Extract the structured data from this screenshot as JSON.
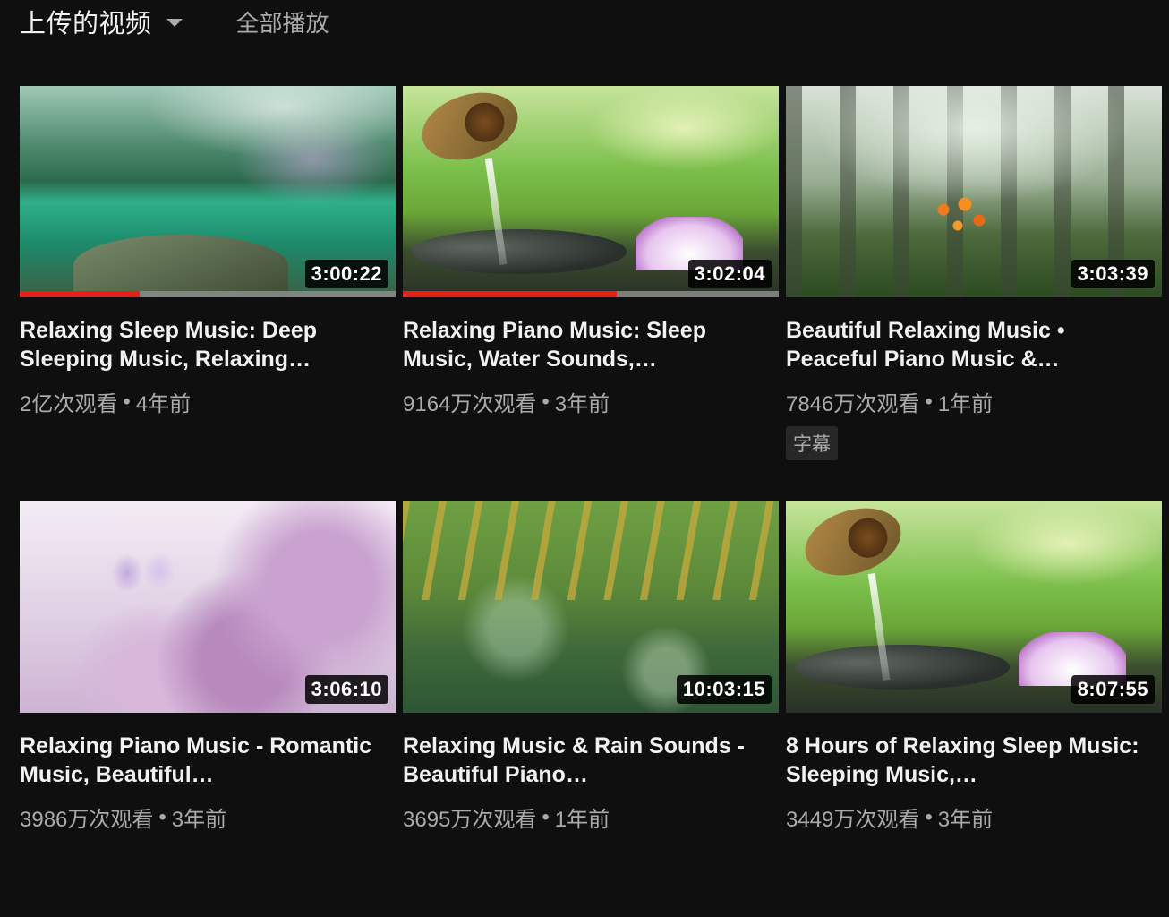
{
  "header": {
    "section_title": "上传的视频",
    "play_all": "全部播放"
  },
  "colors": {
    "background": "#0f0f0f",
    "progress": "#e62117",
    "meta_text": "#aaaaaa"
  },
  "videos": [
    {
      "title": "Relaxing Sleep Music: Deep Sleeping Music, Relaxing…",
      "duration": "3:00:22",
      "views": "2亿次观看",
      "age": "4年前",
      "watch_progress": 0.32,
      "badge": ""
    },
    {
      "title": "Relaxing Piano Music: Sleep Music, Water Sounds,…",
      "duration": "3:02:04",
      "views": "9164万次观看",
      "age": "3年前",
      "watch_progress": 0.57,
      "badge": ""
    },
    {
      "title": "Beautiful Relaxing Music • Peaceful Piano Music &…",
      "duration": "3:03:39",
      "views": "7846万次观看",
      "age": "1年前",
      "watch_progress": 0,
      "badge": "字幕"
    },
    {
      "title": "Relaxing Piano Music - Romantic Music, Beautiful…",
      "duration": "3:06:10",
      "views": "3986万次观看",
      "age": "3年前",
      "watch_progress": 0,
      "badge": ""
    },
    {
      "title": "Relaxing Music & Rain Sounds - Beautiful Piano…",
      "duration": "10:03:15",
      "views": "3695万次观看",
      "age": "1年前",
      "watch_progress": 0,
      "badge": ""
    },
    {
      "title": "8 Hours of Relaxing Sleep Music: Sleeping Music,…",
      "duration": "8:07:55",
      "views": "3449万次观看",
      "age": "3年前",
      "watch_progress": 0,
      "badge": ""
    }
  ],
  "separator": "•"
}
